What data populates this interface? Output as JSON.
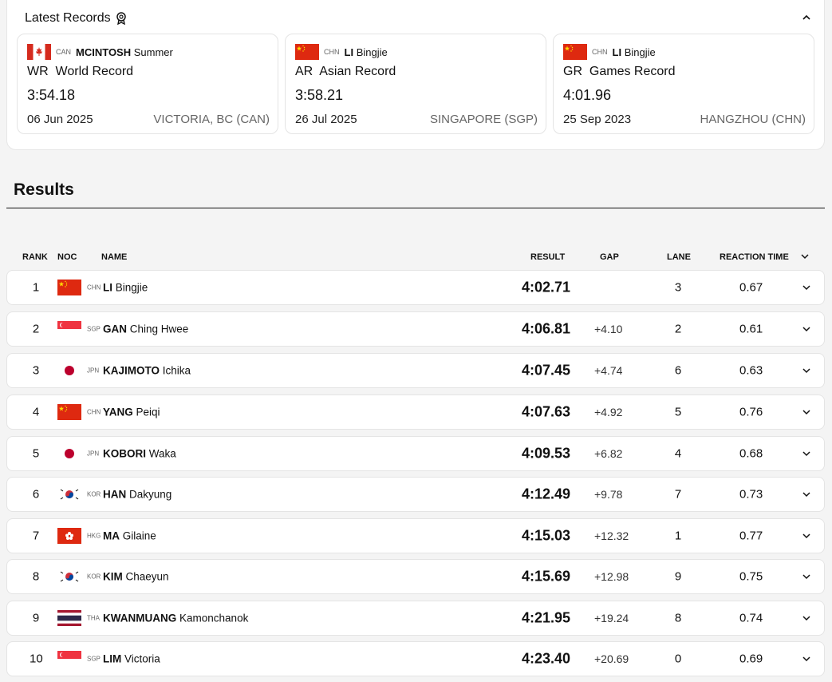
{
  "records": {
    "title": "Latest Records",
    "items": [
      {
        "noc": "CAN",
        "surname": "MCINTOSH",
        "given": "Summer",
        "code": "WR",
        "label": "World Record",
        "time": "3:54.18",
        "date": "06 Jun 2025",
        "location": "VICTORIA, BC (CAN)"
      },
      {
        "noc": "CHN",
        "surname": "LI",
        "given": "Bingjie",
        "code": "AR",
        "label": "Asian Record",
        "time": "3:58.21",
        "date": "26 Jul 2025",
        "location": "SINGAPORE (SGP)"
      },
      {
        "noc": "CHN",
        "surname": "LI",
        "given": "Bingjie",
        "code": "GR",
        "label": "Games Record",
        "time": "4:01.96",
        "date": "25 Sep 2023",
        "location": "HANGZHOU (CHN)"
      }
    ]
  },
  "results": {
    "title": "Results",
    "headers": {
      "rank": "RANK",
      "noc": "NOC",
      "name": "NAME",
      "result": "RESULT",
      "gap": "GAP",
      "lane": "LANE",
      "reaction": "REACTION TIME"
    },
    "rows": [
      {
        "rank": "1",
        "noc": "CHN",
        "surname": "LI",
        "given": "Bingjie",
        "result": "4:02.71",
        "gap": "",
        "lane": "3",
        "reaction": "0.67"
      },
      {
        "rank": "2",
        "noc": "SGP",
        "surname": "GAN",
        "given": "Ching Hwee",
        "result": "4:06.81",
        "gap": "+4.10",
        "lane": "2",
        "reaction": "0.61"
      },
      {
        "rank": "3",
        "noc": "JPN",
        "surname": "KAJIMOTO",
        "given": "Ichika",
        "result": "4:07.45",
        "gap": "+4.74",
        "lane": "6",
        "reaction": "0.63"
      },
      {
        "rank": "4",
        "noc": "CHN",
        "surname": "YANG",
        "given": "Peiqi",
        "result": "4:07.63",
        "gap": "+4.92",
        "lane": "5",
        "reaction": "0.76"
      },
      {
        "rank": "5",
        "noc": "JPN",
        "surname": "KOBORI",
        "given": "Waka",
        "result": "4:09.53",
        "gap": "+6.82",
        "lane": "4",
        "reaction": "0.68"
      },
      {
        "rank": "6",
        "noc": "KOR",
        "surname": "HAN",
        "given": "Dakyung",
        "result": "4:12.49",
        "gap": "+9.78",
        "lane": "7",
        "reaction": "0.73"
      },
      {
        "rank": "7",
        "noc": "HKG",
        "surname": "MA",
        "given": "Gilaine",
        "result": "4:15.03",
        "gap": "+12.32",
        "lane": "1",
        "reaction": "0.77"
      },
      {
        "rank": "8",
        "noc": "KOR",
        "surname": "KIM",
        "given": "Chaeyun",
        "result": "4:15.69",
        "gap": "+12.98",
        "lane": "9",
        "reaction": "0.75"
      },
      {
        "rank": "9",
        "noc": "THA",
        "surname": "KWANMUANG",
        "given": "Kamonchanok",
        "result": "4:21.95",
        "gap": "+19.24",
        "lane": "8",
        "reaction": "0.74"
      },
      {
        "rank": "10",
        "noc": "SGP",
        "surname": "LIM",
        "given": "Victoria",
        "result": "4:23.40",
        "gap": "+20.69",
        "lane": "0",
        "reaction": "0.69"
      }
    ]
  },
  "icons": {
    "records": "medal-icon",
    "collapse": "chevron-up-icon",
    "row_expand": "chevron-down-icon"
  },
  "colors": {
    "china_red": "#de2910",
    "china_yellow": "#ffde00",
    "canada_red": "#d52b1e",
    "sgp_red": "#ef3340",
    "japan_red": "#bc002d",
    "hkg_red": "#de2910",
    "tha_blue": "#2d2a4a",
    "tha_red": "#a51931"
  }
}
